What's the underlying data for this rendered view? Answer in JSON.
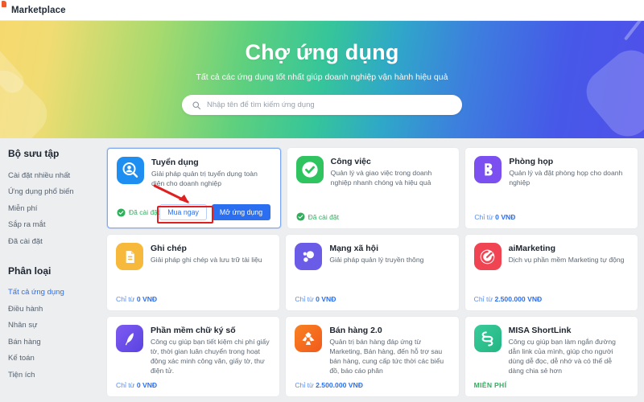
{
  "topbar": {
    "title": "Marketplace",
    "logo_icon": "misa-logo-icon"
  },
  "hero": {
    "title": "Chợ ứng dụng",
    "subtitle": "Tất cả các ứng dụng tốt nhất giúp doanh nghiệp vận hành hiệu quả",
    "search_placeholder": "Nhập tên để tìm kiếm ứng dụng",
    "search_value": "",
    "search_icon": "search-icon",
    "gradient_start": "#f6d96e",
    "gradient_mid": "#35c59a",
    "gradient_end": "#5050ea"
  },
  "sidebar": {
    "collection_heading": "Bộ sưu tập",
    "collection_items": [
      {
        "label": "Cài đặt nhiều nhất",
        "active": false
      },
      {
        "label": "Ứng dụng phổ biến",
        "active": false
      },
      {
        "label": "Miễn phí",
        "active": false
      },
      {
        "label": "Sắp ra mắt",
        "active": false
      },
      {
        "label": "Đã cài đặt",
        "active": false
      }
    ],
    "category_heading": "Phân loại",
    "category_items": [
      {
        "label": "Tất cả ứng dụng",
        "active": true
      },
      {
        "label": "Điều hành",
        "active": false
      },
      {
        "label": "Nhân sự",
        "active": false
      },
      {
        "label": "Bán hàng",
        "active": false
      },
      {
        "label": "Kế toán",
        "active": false
      },
      {
        "label": "Tiện ích",
        "active": false
      }
    ]
  },
  "annotation": {
    "color": "#e02020",
    "target": "Mua ngay",
    "shape": "red-rectangle-with-arrow"
  },
  "cards": [
    {
      "title": "Tuyển dụng",
      "desc": "Giải pháp quản trị tuyển dụng toàn diện cho doanh nghiệp",
      "icon": "recruitment-search-person-icon",
      "icon_color": "#1e8ef1",
      "status": "Đã cài đặt",
      "buy_label": "Mua ngay",
      "open_label": "Mở ứng dụng",
      "highlighted": true
    },
    {
      "title": "Công việc",
      "desc": "Quản lý và giao việc trong doanh nghiệp nhanh chóng và hiệu quả",
      "icon": "task-check-icon",
      "icon_color": "#2fc45f",
      "status": "Đã cài đặt"
    },
    {
      "title": "Phòng họp",
      "desc": "Quản lý và đặt phòng họp cho doanh nghiệp",
      "icon": "meeting-room-icon",
      "icon_color": "#7b4ff0",
      "price_prefix": "Chỉ từ ",
      "price": "0 VNĐ"
    },
    {
      "title": "Ghi chép",
      "desc": "Giải pháp ghi chép và lưu trữ tài liệu",
      "icon": "note-document-icon",
      "icon_color": "#f6b93b",
      "price_prefix": "Chỉ từ ",
      "price": "0 VNĐ"
    },
    {
      "title": "Mạng xã hội",
      "desc": "Giải pháp quản lý truyền thông",
      "icon": "social-network-icon",
      "icon_color": "#6b5ce7",
      "price_prefix": "Chỉ từ ",
      "price": "0 VNĐ"
    },
    {
      "title": "aiMarketing",
      "desc": "Dịch vụ phần mềm Marketing tự động",
      "icon": "marketing-target-icon",
      "icon_color": "#f04452",
      "price_prefix": "Chỉ từ ",
      "price": "2.500.000 VNĐ"
    },
    {
      "title": "Phần mềm chữ ký số",
      "desc": "Công cụ giúp bạn tiết kiệm chi phí giấy tờ, thời gian luân chuyển trong hoạt động xác minh công văn, giấy tờ, thư điện tử.",
      "icon": "digital-signature-pen-icon",
      "icon_color": "#6b5ce7",
      "price_prefix": "Chỉ từ ",
      "price": "0 VNĐ"
    },
    {
      "title": "Bán hàng 2.0",
      "desc": "Quản trị bán hàng đáp ứng từ Marketing, Bán hàng, đến hỗ trợ sau bán hàng, cung cấp tức thời các biểu đồ, báo cáo phân",
      "icon": "sales-pinwheel-icon",
      "icon_color": "#f4701f",
      "price_prefix": "Chỉ từ ",
      "price": "2.500.000 VNĐ"
    },
    {
      "title": "MISA ShortLink",
      "desc": "Công cụ giúp bạn làm ngắn đường dẫn link của mình, giúp cho người dùng dễ đọc, dễ nhớ và có thể dễ dàng chia sẻ hơn",
      "icon": "shortlink-chain-icon",
      "icon_color": "#2fbf8f",
      "free_label": "MIỄN PHÍ"
    }
  ]
}
